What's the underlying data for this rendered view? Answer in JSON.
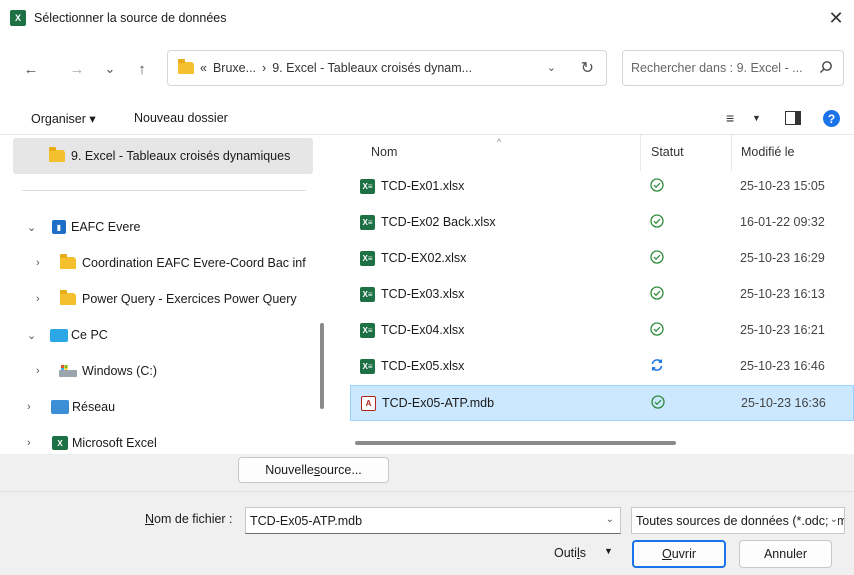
{
  "window": {
    "title": "Sélectionner la source de données",
    "app_icon": "excel-icon",
    "close_glyph": "✕"
  },
  "nav": {
    "back": "←",
    "forward": "→",
    "recent": "⌄",
    "up": "↑",
    "breadcrumb_prefix": "«",
    "crumb_1": "Bruxe...",
    "crumb_sep": "›",
    "crumb_2": "9. Excel - Tableaux croisés dynam...",
    "dropdown": "⌄",
    "refresh": "↻",
    "search_placeholder": "Rechercher dans : 9. Excel - ..."
  },
  "toolbar": {
    "organize": "Organiser ▾",
    "new_folder": "Nouveau dossier",
    "view_glyph": "≡",
    "view_dropdown": "▼",
    "help": "?"
  },
  "sidebar": {
    "selected_folder": "9. Excel - Tableaux croisés dynamiques",
    "items": [
      {
        "label": "EAFC Evere",
        "chevron": "⌄",
        "icon": "building-icon"
      },
      {
        "label": "Coordination EAFC Evere-Coord Bac inf",
        "chevron": "›",
        "icon": "folder-icon"
      },
      {
        "label": "Power Query - Exercices Power Query",
        "chevron": "›",
        "icon": "folder-icon"
      },
      {
        "label": "Ce PC",
        "chevron": "⌄",
        "icon": "pc-icon"
      },
      {
        "label": "Windows (C:)",
        "chevron": "›",
        "icon": "drive-icon"
      },
      {
        "label": "Réseau",
        "chevron": "›",
        "icon": "network-icon"
      },
      {
        "label": "Microsoft Excel",
        "chevron": "›",
        "icon": "excel-icon"
      }
    ]
  },
  "files": {
    "columns": {
      "name": "Nom",
      "status": "Statut",
      "modified": "Modifié le",
      "sort_caret": "^"
    },
    "rows": [
      {
        "name": "TCD-Ex01.xlsx",
        "status": "synced",
        "modified": "25-10-23 15:05",
        "type": "xlsx"
      },
      {
        "name": "TCD-Ex02 Back.xlsx",
        "status": "synced",
        "modified": "16-01-22 09:32",
        "type": "xlsx"
      },
      {
        "name": "TCD-EX02.xlsx",
        "status": "synced",
        "modified": "25-10-23 16:29",
        "type": "xlsx"
      },
      {
        "name": "TCD-Ex03.xlsx",
        "status": "synced",
        "modified": "25-10-23 16:13",
        "type": "xlsx"
      },
      {
        "name": "TCD-Ex04.xlsx",
        "status": "synced",
        "modified": "25-10-23 16:21",
        "type": "xlsx"
      },
      {
        "name": "TCD-Ex05.xlsx",
        "status": "syncing",
        "modified": "25-10-23 16:46",
        "type": "xlsx"
      },
      {
        "name": "TCD-Ex05-ATP.mdb",
        "status": "synced",
        "modified": "25-10-23 16:36",
        "type": "mdb",
        "selected": true
      }
    ],
    "xlsx_glyph": "X≡",
    "mdb_glyph": "A"
  },
  "new_source_button": {
    "before": "Nouvelle ",
    "accel": "s",
    "after": "ource..."
  },
  "bottom": {
    "filename_label_accel": "N",
    "filename_label_rest": "om de fichier :",
    "filename_value": "TCD-Ex05-ATP.mdb",
    "chevron": "⌄",
    "filetype_value": "Toutes sources de données (*.odc;*.mdb)",
    "tools_before": "Outi",
    "tools_accel": "l",
    "tools_after": "s",
    "tools_dropdown": "▼",
    "open_accel": "O",
    "open_rest": "uvrir",
    "cancel": "Annuler"
  },
  "colors": {
    "accent": "#1a73e8",
    "selection_bg": "#cce8ff",
    "excel_green": "#1e7145",
    "status_green": "#2e8b3a",
    "sync_blue": "#1a73e8"
  }
}
